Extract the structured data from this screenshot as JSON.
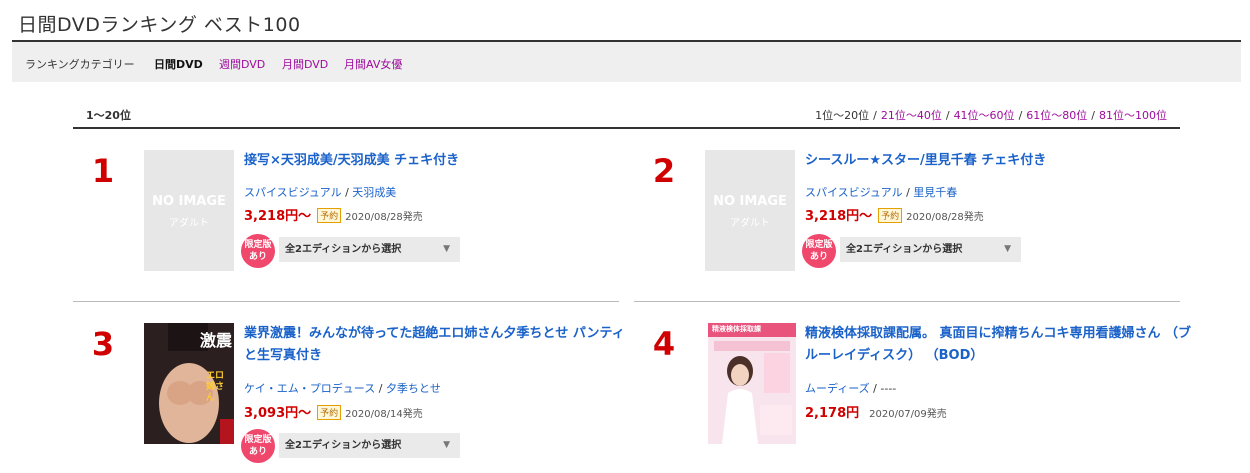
{
  "page": {
    "title": "日間DVDランキング ベスト100"
  },
  "categories": {
    "label": "ランキングカテゴリー",
    "items": [
      {
        "label": "日間DVD",
        "active": true
      },
      {
        "label": "週間DVD",
        "active": false
      },
      {
        "label": "月間DVD",
        "active": false
      },
      {
        "label": "月間AV女優",
        "active": false
      }
    ]
  },
  "range": {
    "current": "1〜20位",
    "links": [
      "1位〜20位",
      "21位〜40位",
      "41位〜60位",
      "61位〜80位",
      "81位〜100位"
    ],
    "separator": "/"
  },
  "items": [
    {
      "rank": "1",
      "title": "接写×天羽成美/天羽成美 チェキ付き",
      "image": {
        "line1": "NO IMAGE",
        "line2": "アダルト"
      },
      "maker": "スパイスビジュアル",
      "actress": "天羽成美",
      "price": "3,218円〜",
      "preorder": "予約",
      "release": "2020/08/28発売",
      "limited": "限定版あり",
      "edition": "全2エディションから選択",
      "has_preorder": true,
      "has_edition": true
    },
    {
      "rank": "2",
      "title": "シースルー★スター/里見千春 チェキ付き",
      "image": {
        "line1": "NO IMAGE",
        "line2": "アダルト"
      },
      "maker": "スパイスビジュアル",
      "actress": "里見千春",
      "price": "3,218円〜",
      "preorder": "予約",
      "release": "2020/08/28発売",
      "limited": "限定版あり",
      "edition": "全2エディションから選択",
      "has_preorder": true,
      "has_edition": true
    },
    {
      "rank": "3",
      "title": "業界激震！みんなが待ってた超絶エロ姉さん夕季ちとせ パンティと生写真付き",
      "image": {
        "line1": "激震",
        "line2": "エロ姉さん"
      },
      "maker": "ケイ・エム・プロデュース",
      "actress": "夕季ちとせ",
      "price": "3,093円〜",
      "preorder": "予約",
      "release": "2020/08/14発売",
      "limited": "限定版あり",
      "edition": "全2エディションから選択",
      "has_preorder": true,
      "has_edition": true
    },
    {
      "rank": "4",
      "title": "精液検体採取課配属。 真面目に搾精ちんコキ専用看護婦さん （ブルーレイディスク） （BOD）",
      "image": {
        "line1": "精液検体採取課",
        "line2": ""
      },
      "maker": "ムーディーズ",
      "actress": "----",
      "price": "2,178円",
      "preorder": "",
      "release": "2020/07/09発売",
      "limited": "",
      "edition": "",
      "has_preorder": false,
      "has_edition": false
    }
  ],
  "colors": {
    "accent_purple": "#9e0b9e",
    "link_blue": "#1a62c9",
    "rank_red": "#d00000",
    "limited_pink": "#f0476c"
  }
}
